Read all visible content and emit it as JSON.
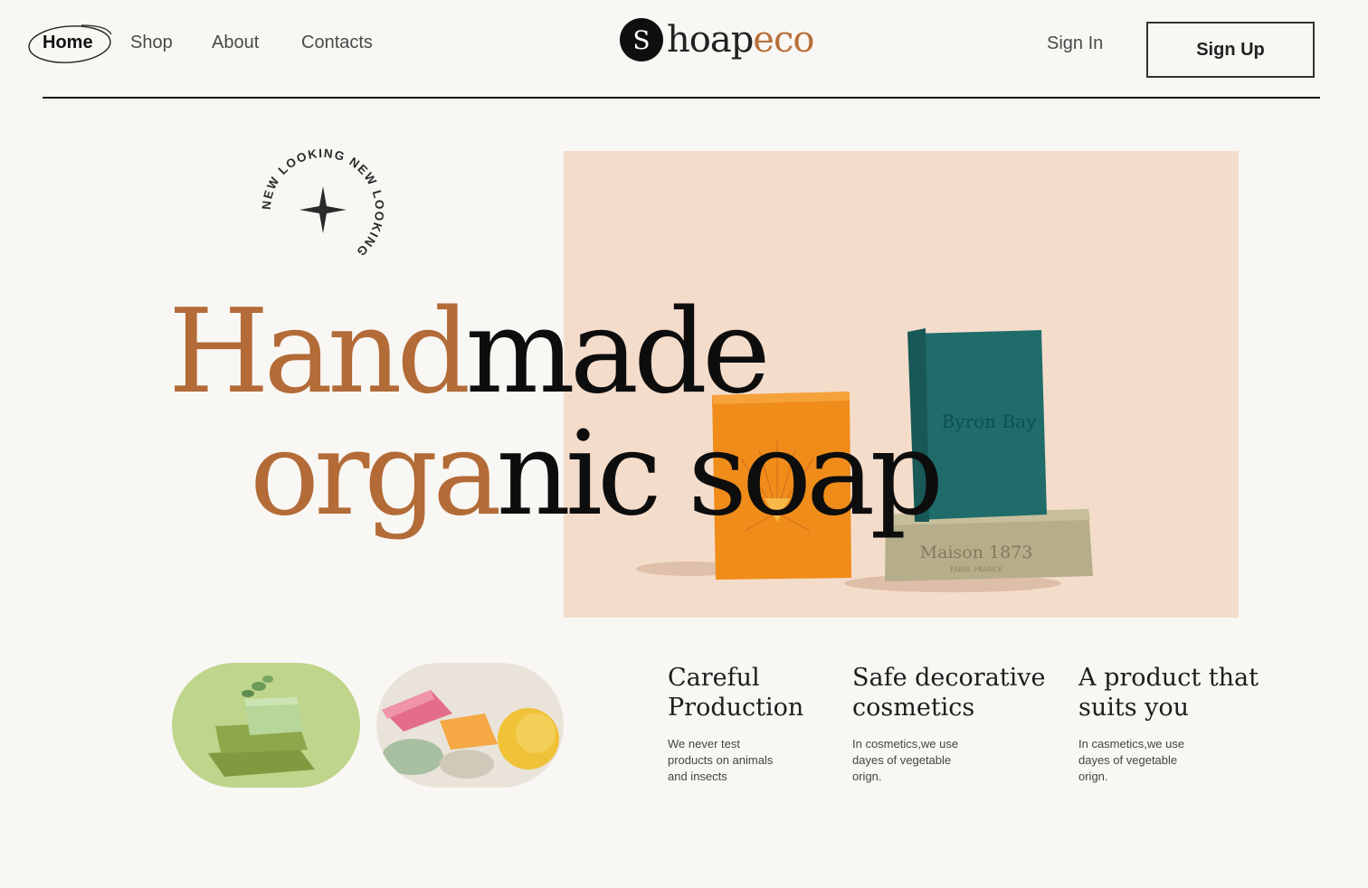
{
  "nav": {
    "home": "Home",
    "shop": "Shop",
    "about": "About",
    "contacts": "Contacts"
  },
  "logo": {
    "initial": "S",
    "text_dark": "hoap",
    "text_accent": "eco"
  },
  "auth": {
    "signin": "Sign In",
    "signup": "Sign Up"
  },
  "badge": {
    "text": "NEW LOOKING NEW LOOKING"
  },
  "hero": {
    "line1_accent": "Hand",
    "line1_dark": "made",
    "line2_accent": "orga",
    "line2_dark": "nic soap"
  },
  "products": {
    "bar1_label": "Byron Bay",
    "bar2_label": "Maison 1873",
    "bar2_sub": "PARIS, FRANCE"
  },
  "features": [
    {
      "title_line1": "Careful",
      "title_line2": "Production",
      "text_line1": "We never test",
      "text_line2": "products on animals",
      "text_line3": "and insects"
    },
    {
      "title_line1": "Safe decorative",
      "title_line2": "cosmetics",
      "text_line1": "In cosmetics,we use",
      "text_line2": "dayes of vegetable",
      "text_line3": "orign."
    },
    {
      "title_line1": "A product that",
      "title_line2": "suits you",
      "text_line1": "In casmetics,we use",
      "text_line2": "dayes of vegetable",
      "text_line3": "orign."
    }
  ],
  "colors": {
    "accent": "#b36b38",
    "background": "#f9f7f3",
    "hero_panel": "#f4dccb"
  }
}
